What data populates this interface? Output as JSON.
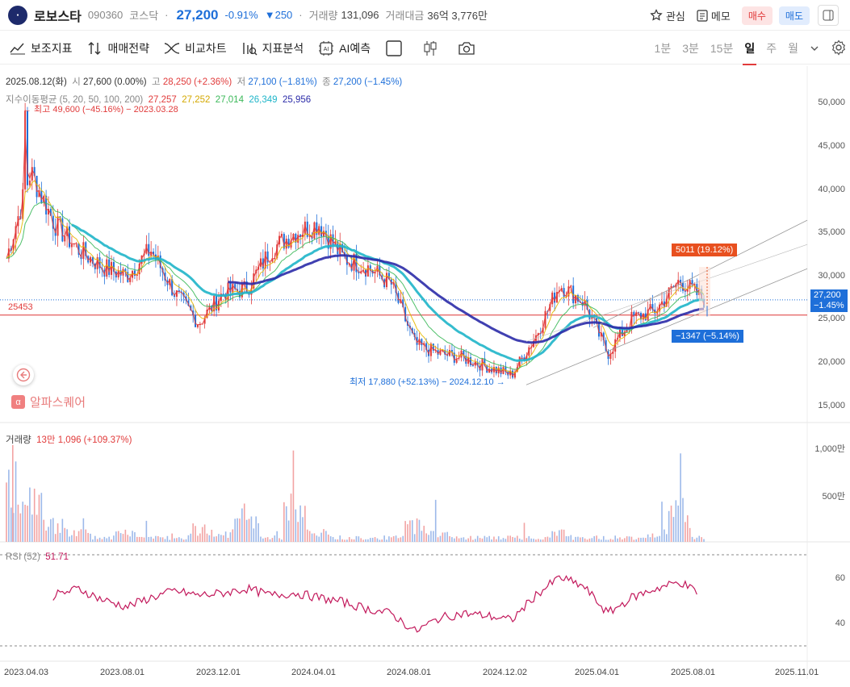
{
  "header": {
    "stock_name": "로보스타",
    "code": "090360",
    "market": "코스닥",
    "price": "27,200",
    "change_pct": "-0.91%",
    "change_abs": "250",
    "volume_label": "거래량",
    "volume": "131,096",
    "amount_label": "거래대금",
    "amount": "36억 3,776만",
    "watch": "관심",
    "memo": "메모",
    "buy": "매수",
    "sell": "매도"
  },
  "toolbar": {
    "tools": [
      "보조지표",
      "매매전략",
      "비교차트",
      "지표분석",
      "AI예측"
    ],
    "timeframes": [
      "1분",
      "3분",
      "15분",
      "일",
      "주",
      "월"
    ],
    "active_timeframe": "일"
  },
  "ohlc": {
    "date": "2025.08.12(화)",
    "open_label": "시",
    "open": "27,600 (0.00%)",
    "high_label": "고",
    "high": "28,250 (+2.36%)",
    "low_label": "저",
    "low": "27,100 (−1.81%)",
    "close_label": "종",
    "close": "27,200 (−1.45%)"
  },
  "ma": {
    "label": "지수이동평균 (5, 20, 50, 100, 200)",
    "values": [
      "27,257",
      "27,252",
      "27,014",
      "26,349",
      "25,956"
    ],
    "colors": [
      "#e13b3b",
      "#e6b800",
      "#3cb95a",
      "#1fb5c9",
      "#2b2ba8"
    ]
  },
  "annotations": {
    "high_note": "← 최고 49,600 (−45.16%) − 2023.03.28",
    "low_note": "최저 17,880 (+52.13%) − 2024.12.10 →",
    "hline_value": "25453",
    "up_tag": "5011 (19.12%)",
    "down_tag": "−1347 (−5.14%)",
    "price_tag": "27,200",
    "price_tag_pct": "−1.45%"
  },
  "price_axis": [
    "50,000",
    "45,000",
    "40,000",
    "35,000",
    "30,000",
    "25,000",
    "20,000",
    "15,000"
  ],
  "volume_panel": {
    "label": "거래량",
    "value": "13만 1,096 (+109.37%)",
    "axis": [
      "1,000만",
      "500만"
    ]
  },
  "rsi_panel": {
    "label": "RSI (52)",
    "value": "51.71",
    "axis": [
      "60",
      "40"
    ]
  },
  "x_axis": [
    "2023.04.03",
    "2023.08.01",
    "2023.12.01",
    "2024.04.01",
    "2024.08.01",
    "2024.12.02",
    "2025.04.01",
    "2025.08.01",
    "2025.11.01"
  ],
  "brand": {
    "alpha_label": "알파스퀘어"
  },
  "chart_data": {
    "type": "line",
    "x_range": [
      "2023.03",
      "2025.11"
    ],
    "ylim": [
      15000,
      52000
    ],
    "x": [
      "2023.03",
      "2023.04",
      "2023.05",
      "2023.06",
      "2023.07",
      "2023.08",
      "2023.09",
      "2023.10",
      "2023.11",
      "2023.12",
      "2024.01",
      "2024.02",
      "2024.03",
      "2024.04",
      "2024.05",
      "2024.06",
      "2024.07",
      "2024.08",
      "2024.09",
      "2024.10",
      "2024.11",
      "2024.12",
      "2025.01",
      "2025.02",
      "2025.03",
      "2025.04",
      "2025.05",
      "2025.06",
      "2025.07",
      "2025.08"
    ],
    "series": [
      {
        "name": "close",
        "values": [
          32000,
          42000,
          36000,
          33000,
          31000,
          30000,
          33000,
          28000,
          24500,
          28000,
          28500,
          33000,
          35000,
          36000,
          32000,
          31000,
          29000,
          22000,
          21000,
          20500,
          19500,
          18500,
          23000,
          29000,
          27000,
          21000,
          25000,
          26000,
          29500,
          27200
        ]
      },
      {
        "name": "EMA200",
        "values": [
          null,
          null,
          null,
          null,
          null,
          null,
          null,
          null,
          null,
          null,
          31000,
          31200,
          31400,
          31700,
          31400,
          30800,
          30000,
          29000,
          28000,
          27200,
          26300,
          25300,
          25300,
          25600,
          25700,
          25400,
          25300,
          25400,
          25700,
          25956
        ]
      }
    ],
    "volume_millions": [
      13,
      9,
      4,
      2,
      1,
      2,
      1,
      1,
      3,
      2,
      6,
      1,
      8,
      2,
      1,
      1,
      1,
      4,
      2,
      1,
      1,
      1,
      1,
      2,
      1,
      1,
      1,
      2,
      7,
      1.3
    ],
    "rsi": [
      50,
      48,
      52,
      55,
      50,
      47,
      51,
      54,
      52,
      53,
      55,
      52,
      53,
      51,
      49,
      46,
      44,
      36,
      42,
      44,
      43,
      41,
      52,
      60,
      56,
      44,
      51,
      55,
      58,
      51.71
    ]
  }
}
